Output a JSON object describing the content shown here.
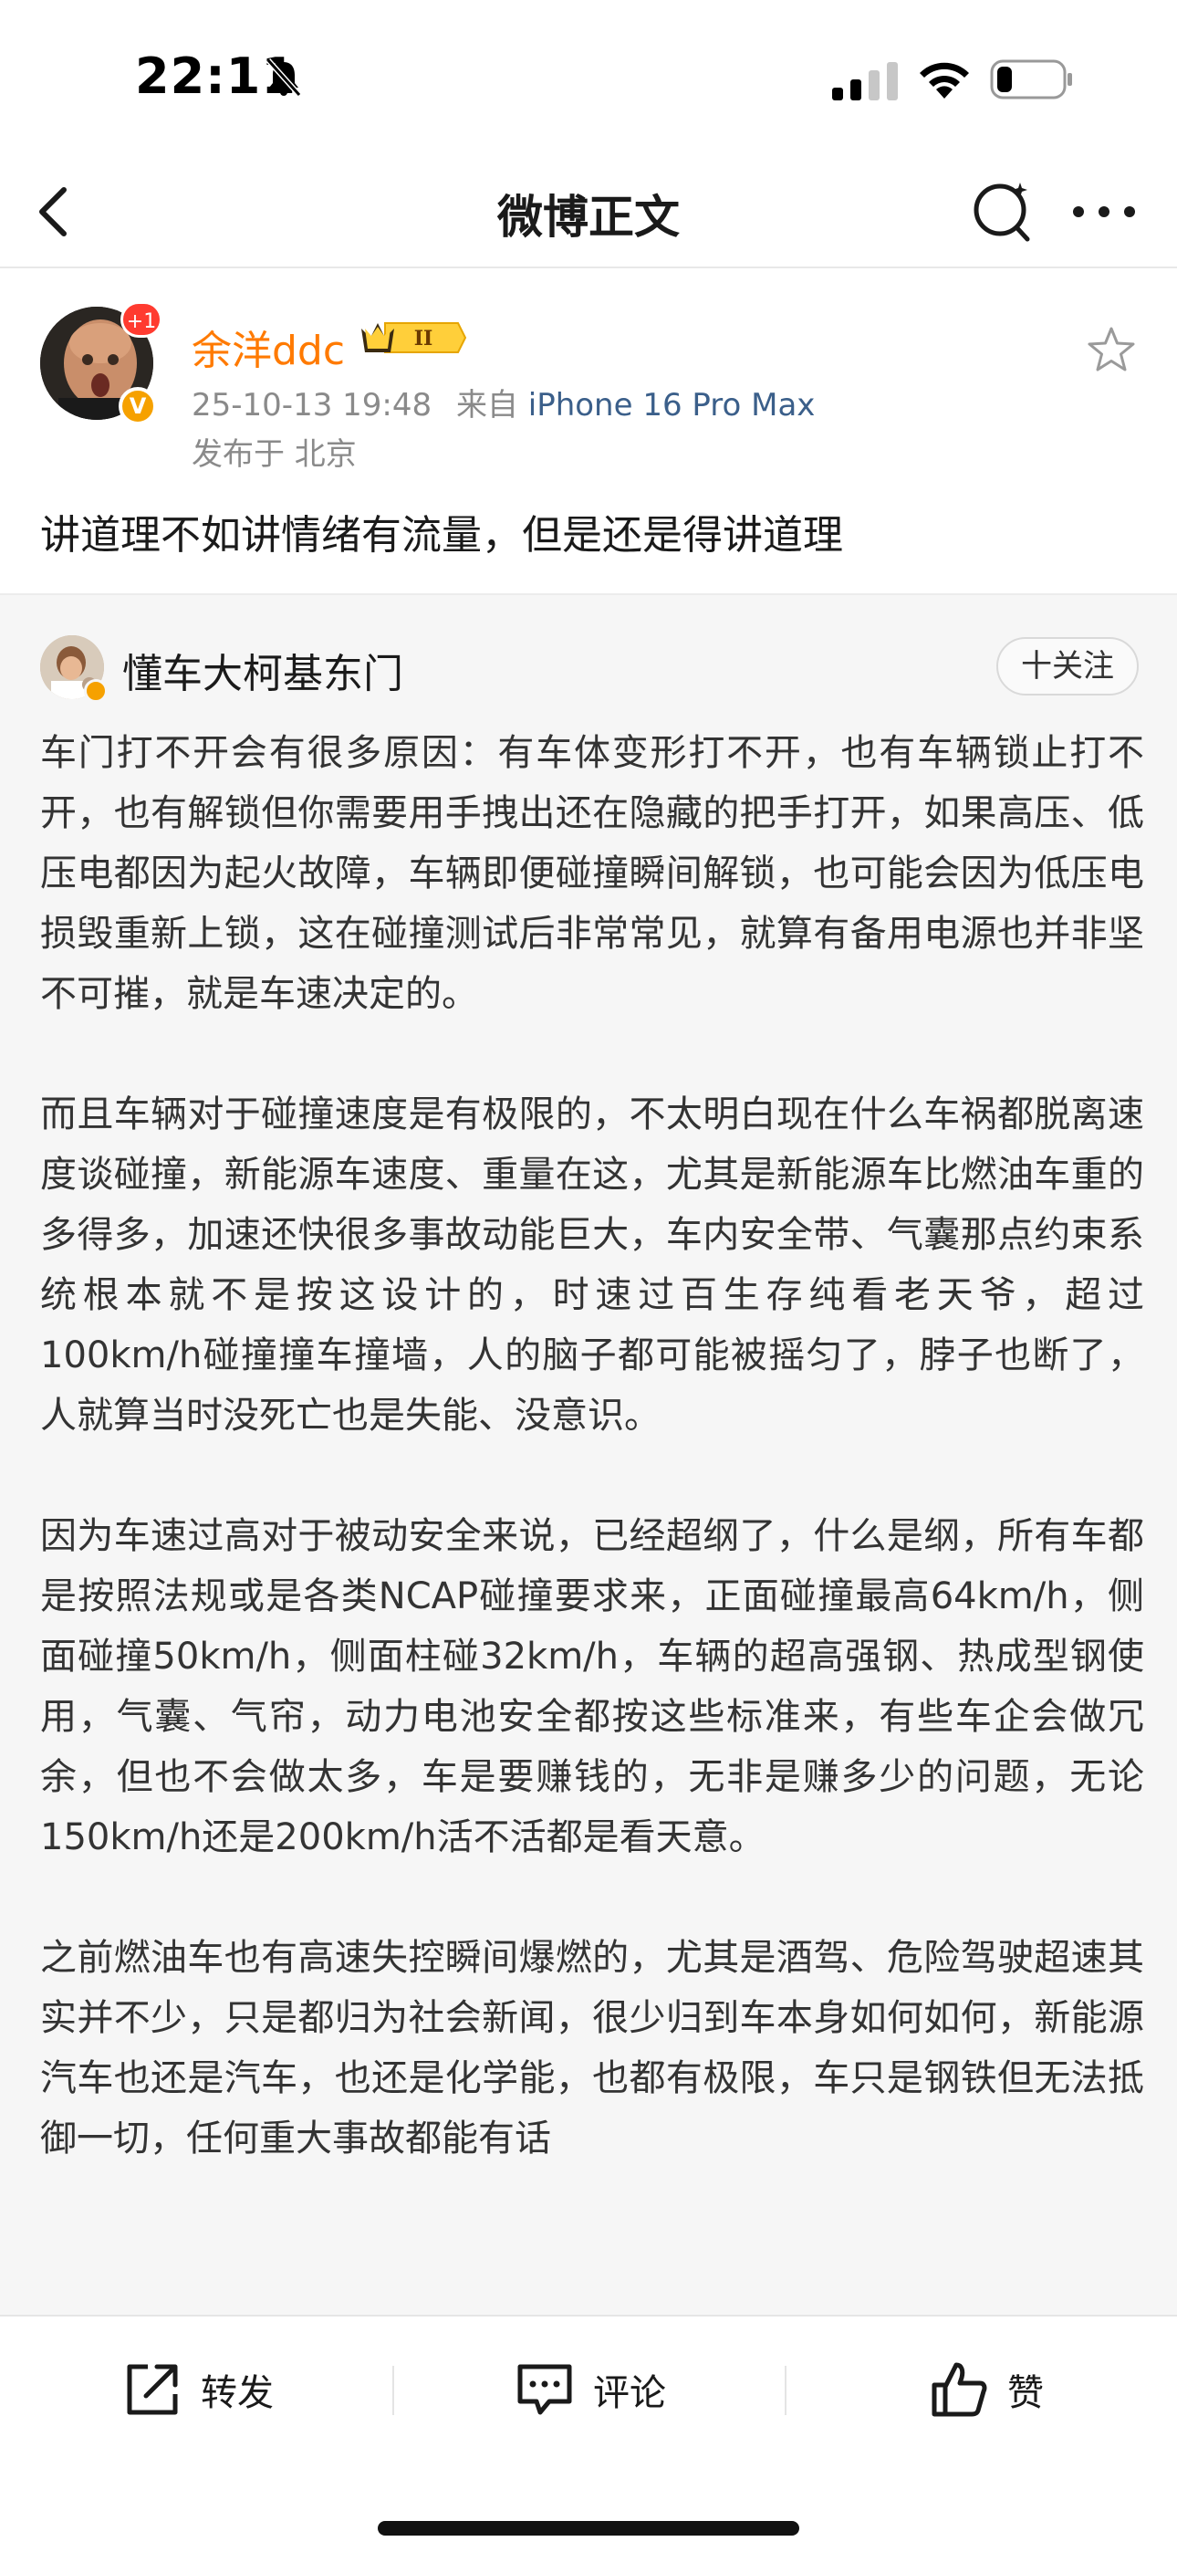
{
  "status_bar": {
    "time": "22:11"
  },
  "nav": {
    "title": "微博正文"
  },
  "post": {
    "author": "余洋ddc",
    "notification_badge": "+1",
    "vip_level": "II",
    "timestamp": "25-10-13 19:48",
    "source_prefix": "来自",
    "source": "iPhone 16 Pro Max",
    "location": "发布于 北京",
    "text": "讲道理不如讲情绪有流量，但是还是得讲道理"
  },
  "repost": {
    "author": "懂车大柯基东门",
    "follow_label": "十关注",
    "paragraphs": [
      "车门打不开会有很多原因：有车体变形打不开，也有车辆锁止打不开，也有解锁但你需要用手拽出还在隐藏的把手打开，如果高压、低压电都因为起火故障，车辆即便碰撞瞬间解锁，也可能会因为低压电损毁重新上锁，这在碰撞测试后非常常见，就算有备用电源也并非坚不可摧，就是车速决定的。",
      "而且车辆对于碰撞速度是有极限的，不太明白现在什么车祸都脱离速度谈碰撞，新能源车速度、重量在这，尤其是新能源车比燃油车重的多得多，加速还快很多事故动能巨大，车内安全带、气囊那点约束系统根本就不是按这设计的，时速过百生存纯看老天爷，超过100km/h碰撞撞车撞墙，人的脑子都可能被摇匀了，脖子也断了，人就算当时没死亡也是失能、没意识。",
      "因为车速过高对于被动安全来说，已经超纲了，什么是纲，所有车都是按照法规或是各类NCAP碰撞要求来，正面碰撞最高64km/h，侧面碰撞50km/h，侧面柱碰32km/h，车辆的超高强钢、热成型钢使用，气囊、气帘，动力电池安全都按这些标准来，有些车企会做冗余，但也不会做太多，车是要赚钱的，无非是赚多少的问题，无论150km/h还是200km/h活不活都是看天意。",
      "之前燃油车也有高速失控瞬间爆燃的，尤其是酒驾、危险驾驶超速其实并不少，只是都归为社会新闻，很少归到车本身如何如何，新能源汽车也还是汽车，也还是化学能，也都有极限，车只是钢铁但无法抵御一切，任何重大事故都能有话"
    ]
  },
  "toolbar": {
    "repost_label": "转发",
    "comment_label": "评论",
    "like_label": "赞"
  }
}
